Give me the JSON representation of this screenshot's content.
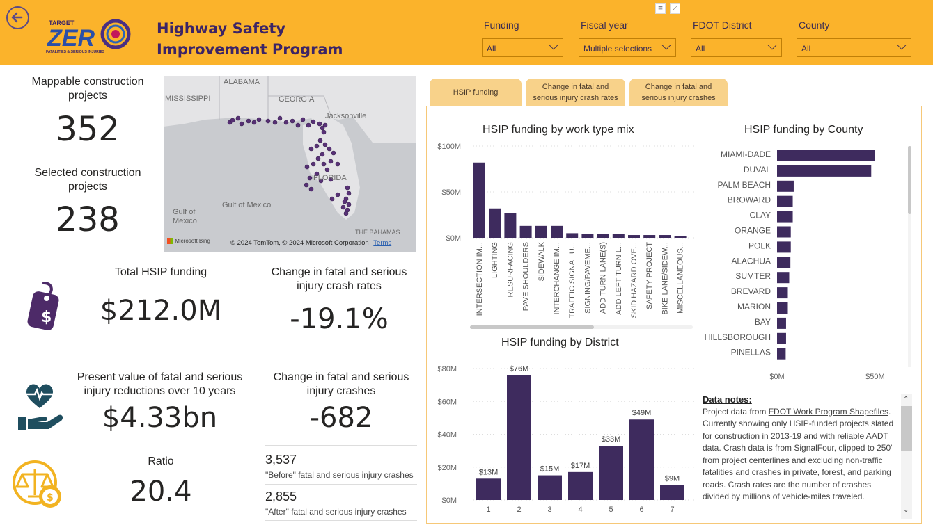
{
  "header": {
    "title": "Highway Safety Improvement Program",
    "logo_text": "TARGET ZERO",
    "logo_sub": "FATALITIES & SERIOUS INJURIES",
    "filters": [
      {
        "label": "Funding",
        "value": "All"
      },
      {
        "label": "Fiscal year",
        "value": "Multiple selections"
      },
      {
        "label": "FDOT District",
        "value": "All"
      },
      {
        "label": "County",
        "value": "All"
      }
    ]
  },
  "kpis": {
    "mappable_label": "Mappable construction projects",
    "mappable_value": "352",
    "selected_label": "Selected construction projects",
    "selected_value": "238",
    "funding_label": "Total HSIP funding",
    "funding_value": "$212.0M",
    "rate_change_label": "Change in fatal and serious injury crash rates",
    "rate_change_value": "-19.1%",
    "pv_label": "Present value of fatal and serious injury reductions over 10 years",
    "pv_value": "$4.33bn",
    "crash_change_label": "Change in fatal and serious injury crashes",
    "crash_change_value": "-682",
    "ratio_label": "Ratio",
    "ratio_value": "20.4",
    "before_value": "3,537",
    "before_label": "\"Before\" fatal and serious injury crashes",
    "after_value": "2,855",
    "after_label": "\"After\" fatal and serious injury crashes"
  },
  "map": {
    "labels": [
      "ALABAMA",
      "MISSISSIPPI",
      "GEORGIA",
      "Jacksonville",
      "FLORIDA",
      "Gulf of Mexico",
      "Gulf of Mexico",
      "THE BAHAMAS"
    ],
    "brand": "Microsoft Bing",
    "copyright": "© 2024 TomTom, © 2024 Microsoft Corporation",
    "terms": "Terms"
  },
  "tabs": [
    {
      "label": "HSIP funding"
    },
    {
      "label": "Change in fatal and serious injury crash rates"
    },
    {
      "label": "Change in fatal and serious injury crashes"
    }
  ],
  "chart_data": [
    {
      "type": "bar",
      "title": "HSIP funding by work type mix",
      "categories": [
        "INTERSECTION IM...",
        "LIGHTING",
        "RESURFACING",
        "PAVE SHOULDERS",
        "SIDEWALK",
        "INTERCHANGE IM...",
        "TRAFFIC SIGNAL U...",
        "SIGNING/PAVEME...",
        "ADD TURN LANE(S)",
        "ADD LEFT TURN L...",
        "SKID HAZARD OVE...",
        "SAFETY PROJECT",
        "BIKE LANE/SIDEW...",
        "MISCELLANEOUS..."
      ],
      "values": [
        82,
        32,
        27,
        13,
        13,
        13,
        5,
        4,
        4,
        4,
        3,
        3,
        3,
        2
      ],
      "yticks": [
        "$100M",
        "$50M",
        "$0M"
      ],
      "ylim": [
        0,
        100
      ],
      "color": "#3e2b5e"
    },
    {
      "type": "bar",
      "title": "HSIP funding by District",
      "categories": [
        "1",
        "2",
        "3",
        "4",
        "5",
        "6",
        "7"
      ],
      "values": [
        13,
        76,
        15,
        17,
        33,
        49,
        9
      ],
      "data_labels": [
        "$13M",
        "$76M",
        "$15M",
        "$17M",
        "$33M",
        "$49M",
        "$9M"
      ],
      "yticks": [
        "$80M",
        "$60M",
        "$40M",
        "$20M",
        "$0M"
      ],
      "ylim": [
        0,
        80
      ],
      "color": "#3e2b5e"
    },
    {
      "type": "bar",
      "orientation": "horizontal",
      "title": "HSIP funding by County",
      "categories": [
        "MIAMI-DADE",
        "DUVAL",
        "PALM BEACH",
        "BROWARD",
        "CLAY",
        "ORANGE",
        "POLK",
        "ALACHUA",
        "SUMTER",
        "BREVARD",
        "MARION",
        "BAY",
        "HILLSBOROUGH",
        "PINELLAS"
      ],
      "values": [
        50,
        48,
        8.5,
        8,
        8,
        7,
        7,
        6.8,
        6.2,
        5.5,
        5.5,
        4.6,
        4.6,
        4.4
      ],
      "xticks": [
        "$0M",
        "$50M"
      ],
      "xlim": [
        0,
        55
      ],
      "color": "#3e2b5e"
    }
  ],
  "notes": {
    "heading": "Data notes:",
    "intro": "Project data from ",
    "link": "FDOT Work Program Shapefiles",
    "body": ". Currently showing only HSIP-funded projects slated for construction in 2013-19 and with reliable AADT data. Crash data is from SignalFour, clipped to 250' from project centerlines and excluding non-traffic fatalities and crashes in private, forest, and parking roads. Crash rates are the number of crashes divided by millions of vehicle-miles traveled."
  },
  "colors": {
    "header": "#fbb32b",
    "accent_purple": "#3e2b5e",
    "icon_teal": "#1f4e5f",
    "icon_gold": "#f2b321"
  }
}
